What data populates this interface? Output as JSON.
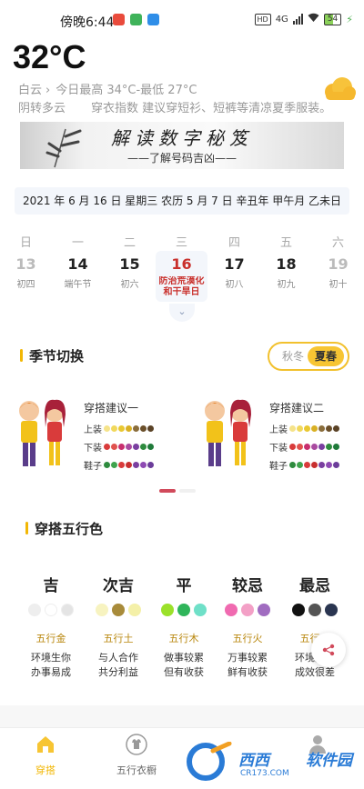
{
  "status_bar": {
    "time": "傍晚6:44",
    "network": "4G",
    "battery": "54",
    "hd": "HD",
    "app_icons": [
      {
        "name": "app-icon-red",
        "color": "#e94b3c"
      },
      {
        "name": "app-icon-green",
        "color": "#3fb35a"
      },
      {
        "name": "app-icon-blue",
        "color": "#2f8ee8"
      }
    ]
  },
  "weather": {
    "temperature": "32°C",
    "condition": "白云",
    "today_range": "今日最高 34°C-最低 27°C",
    "later": "阴转多云",
    "dressing_advice": "穿衣指数 建议穿短衫、短裤等清凉夏季服装。",
    "icon": "cloud-icon"
  },
  "banner": {
    "title": "解读数字秘笈",
    "subtitle": "——了解号码吉凶——"
  },
  "date_line": "2021 年 6 月 16 日 星期三 农历 5 月 7 日 辛丑年 甲午月 乙未日",
  "calendar": {
    "days": [
      {
        "weekday": "日",
        "day": "13",
        "lunar": "初四",
        "faded": true
      },
      {
        "weekday": "一",
        "day": "14",
        "lunar": "端午节",
        "faded": false
      },
      {
        "weekday": "二",
        "day": "15",
        "lunar": "初六",
        "faded": false
      },
      {
        "weekday": "三",
        "day": "16",
        "lunar": "防治荒漠化和干旱日",
        "faded": false,
        "today": true
      },
      {
        "weekday": "四",
        "day": "17",
        "lunar": "初八",
        "faded": false
      },
      {
        "weekday": "五",
        "day": "18",
        "lunar": "初九",
        "faded": false
      },
      {
        "weekday": "六",
        "day": "19",
        "lunar": "初十",
        "faded": true
      }
    ],
    "expand_icon": "chevron-down-icon"
  },
  "season_section": {
    "title": "季节切换",
    "options": [
      "秋冬",
      "夏春"
    ],
    "selected": "夏春"
  },
  "outfits": [
    {
      "name": "穿搭建议一",
      "rows": [
        {
          "label": "上装",
          "colors": [
            "#f5e38a",
            "#f1d85c",
            "#e9c832",
            "#d9b024",
            "#8a6d3b",
            "#6b4f2a",
            "#5a4226"
          ]
        },
        {
          "label": "下装",
          "colors": [
            "#d93b3b",
            "#e0524e",
            "#c82f6e",
            "#a94aa0",
            "#7a3fa0",
            "#2e8b3e",
            "#1f7a3a"
          ]
        },
        {
          "label": "鞋子",
          "colors": [
            "#2e8b3e",
            "#3fa34d",
            "#d93b3b",
            "#c82f2f",
            "#7a3fa0",
            "#8e4ab3",
            "#6b3d9a"
          ]
        }
      ]
    },
    {
      "name": "穿搭建议二",
      "rows": [
        {
          "label": "上装",
          "colors": [
            "#f5e38a",
            "#f1d85c",
            "#e9c832",
            "#d9b024",
            "#8a6d3b",
            "#6b4f2a",
            "#5a4226"
          ]
        },
        {
          "label": "下装",
          "colors": [
            "#d93b3b",
            "#e0524e",
            "#c82f6e",
            "#a94aa0",
            "#7a3fa0",
            "#2e8b3e",
            "#1f7a3a"
          ]
        },
        {
          "label": "鞋子",
          "colors": [
            "#2e8b3e",
            "#3fa34d",
            "#d93b3b",
            "#c82f2f",
            "#7a3fa0",
            "#8e4ab3",
            "#6b3d9a"
          ]
        }
      ]
    }
  ],
  "five_elements_section": {
    "title": "穿搭五行色",
    "columns": [
      {
        "name": "吉",
        "element": "五行金",
        "desc1": "环境生你",
        "desc2": "办事易成",
        "colors": [
          "#eeeeee",
          "#ffffff",
          "#e4e4e4"
        ]
      },
      {
        "name": "次吉",
        "element": "五行土",
        "desc1": "与人合作",
        "desc2": "共分利益",
        "colors": [
          "#f7f3c0",
          "#a88b3a",
          "#f4f0a8"
        ]
      },
      {
        "name": "平",
        "element": "五行木",
        "desc1": "做事较累",
        "desc2": "但有收获",
        "colors": [
          "#9be12a",
          "#2fb55a",
          "#6fe0c8"
        ]
      },
      {
        "name": "较忌",
        "element": "五行火",
        "desc1": "万事较累",
        "desc2": "鲜有收获",
        "colors": [
          "#f06ab0",
          "#f3a0c6",
          "#a06cc0"
        ]
      },
      {
        "name": "最忌",
        "element": "五行水",
        "desc1": "环境克你",
        "desc2": "成效很差",
        "colors": [
          "#111111",
          "#555555",
          "#2a3550"
        ]
      }
    ]
  },
  "bottom_nav": {
    "items": [
      {
        "label": "穿搭",
        "icon": "home-icon",
        "active": true
      },
      {
        "label": "五行衣橱",
        "icon": "shirt-icon",
        "active": false
      }
    ]
  },
  "watermark": {
    "brand1": "西西",
    "brand2": "软件园",
    "url": "CR173.COM"
  },
  "colors": {
    "accent": "#f2b705",
    "today_red": "#c9302c",
    "weather_gray": "#999999"
  }
}
